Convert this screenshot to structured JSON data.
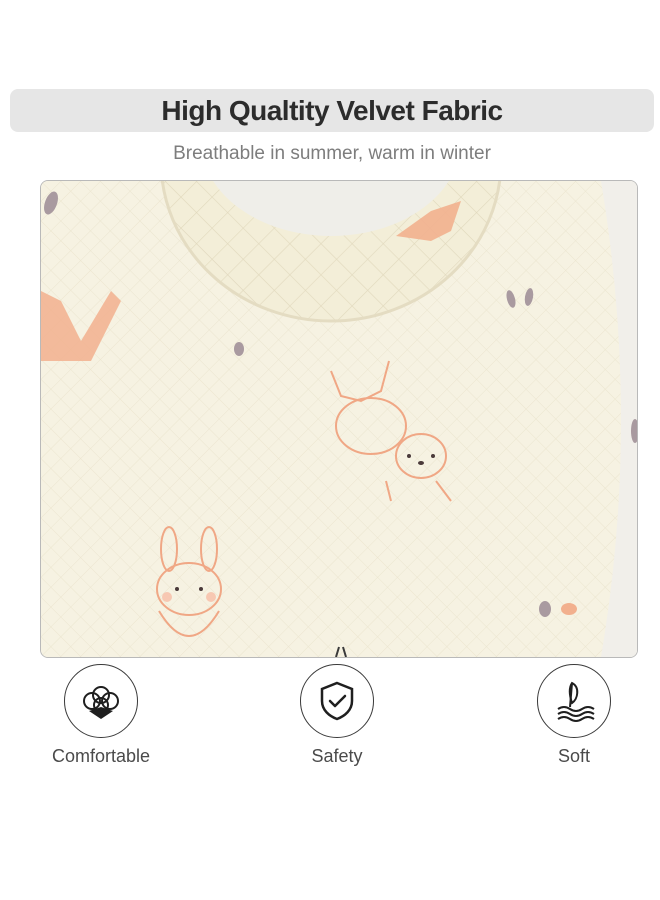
{
  "header": {
    "title": "High Qualtity Velvet Fabric",
    "subtitle": "Breathable in summer, warm in winter"
  },
  "photo": {
    "subject": "bunny-print-bib",
    "colors": {
      "fabric": "#f6f2e2",
      "background": "#f1efea",
      "accent": "#f0a785"
    }
  },
  "features": [
    {
      "label": "Comfortable",
      "icon": "cotton-flower-icon"
    },
    {
      "label": "Safety",
      "icon": "shield-check-icon"
    },
    {
      "label": "Soft",
      "icon": "feather-wave-icon"
    }
  ]
}
